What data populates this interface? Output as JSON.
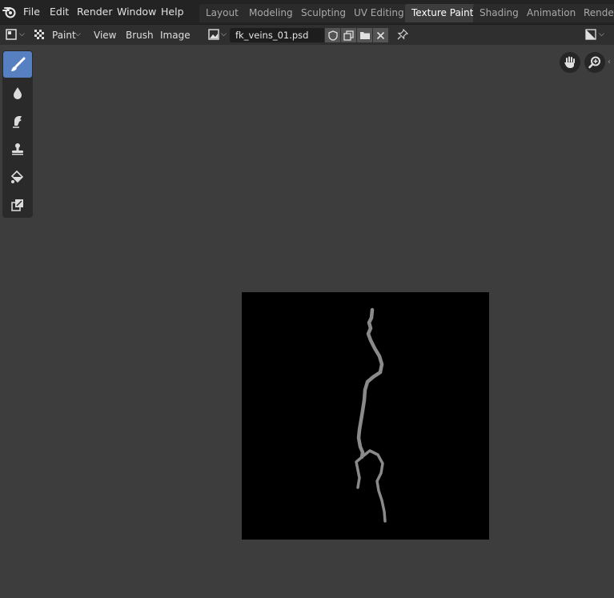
{
  "menu": {
    "items": [
      "File",
      "Edit",
      "Render",
      "Window",
      "Help"
    ]
  },
  "workspaces": {
    "tabs": [
      "Layout",
      "Modeling",
      "Sculpting",
      "UV Editing",
      "Texture Paint",
      "Shading",
      "Animation",
      "Renderi"
    ],
    "active": "Texture Paint"
  },
  "header": {
    "mode_label": "Paint",
    "view_menu": "View",
    "brush_menu": "Brush",
    "image_menu": "Image",
    "image_name": "fk_veins_01.psd"
  },
  "toolbar": {
    "tools": [
      "draw-tool",
      "soften-tool",
      "smear-tool",
      "clone-tool",
      "fill-tool",
      "mask-tool"
    ],
    "active_tool": "draw-tool"
  },
  "colors": {
    "active_tool": "#5680c2",
    "topbar": "#232323",
    "header": "#2f2f2f",
    "viewport": "#3d3d3d",
    "canvas": "#000000",
    "vein": "#8a8a8a"
  }
}
